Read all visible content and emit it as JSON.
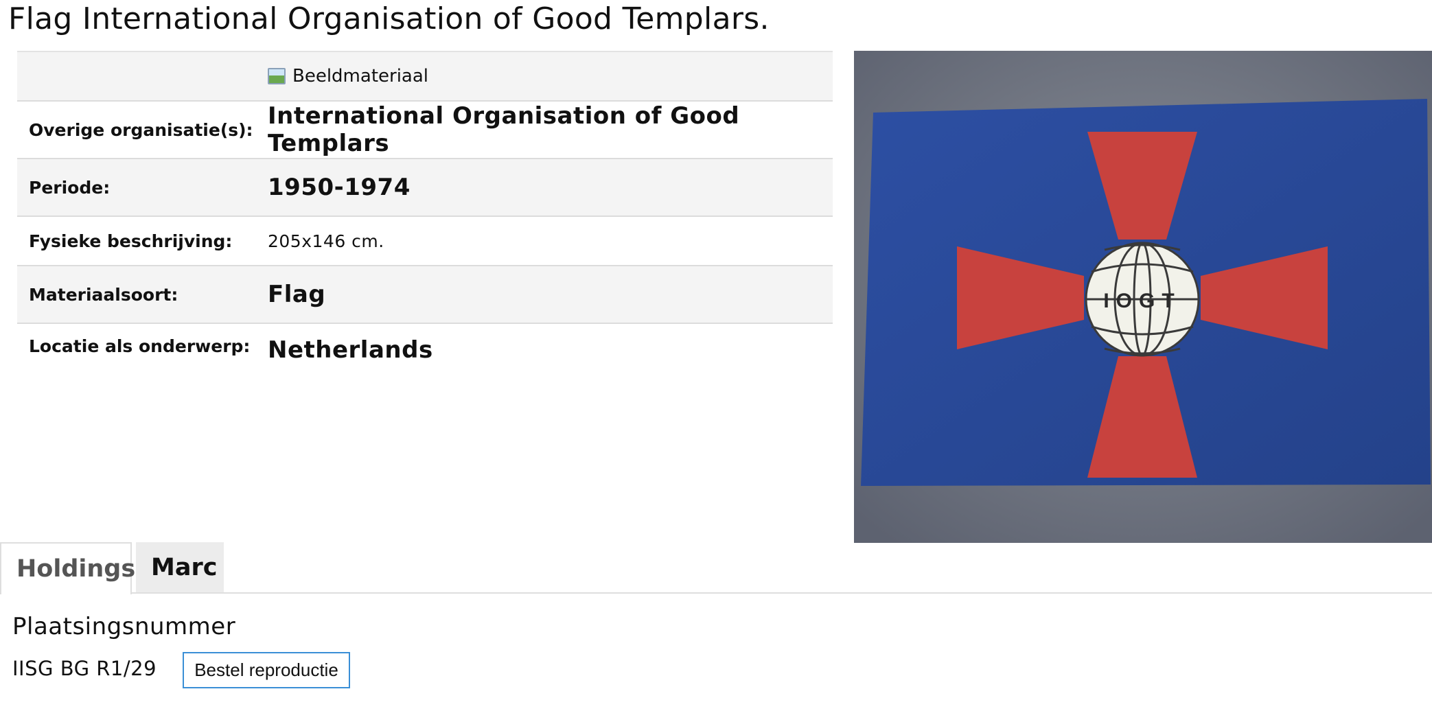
{
  "page": {
    "title": "Flag International Organisation of Good Templars."
  },
  "record": {
    "material_type": "Beeldmateriaal",
    "fields": [
      {
        "label": "Overige organisatie(s):",
        "value": "International Organisation of Good Templars"
      },
      {
        "label": "Periode:",
        "value": "1950-1974"
      },
      {
        "label": "Fysieke beschrijving:",
        "value": "205x146 cm."
      },
      {
        "label": "Materiaalsoort:",
        "value": "Flag"
      },
      {
        "label": "Locatie als onderwerp:",
        "value": "Netherlands"
      }
    ]
  },
  "image": {
    "emblem_text": "IOGT",
    "colors": {
      "flag": "#2a4a9c",
      "cross": "#c8423e",
      "background": "#7b808a",
      "globe": "#f2f2ea"
    }
  },
  "tabs": [
    {
      "label": "Holdings",
      "active": true
    },
    {
      "label": "Marc",
      "active": false
    }
  ],
  "holdings": {
    "heading": "Plaatsingsnummer",
    "shelfmark": "IISG BG R1/29",
    "order_button": "Bestel reproductie"
  },
  "colors": {
    "button_border": "#3a8fd6",
    "divider": "#dcdcdc",
    "row_alt": "#f4f4f4"
  }
}
